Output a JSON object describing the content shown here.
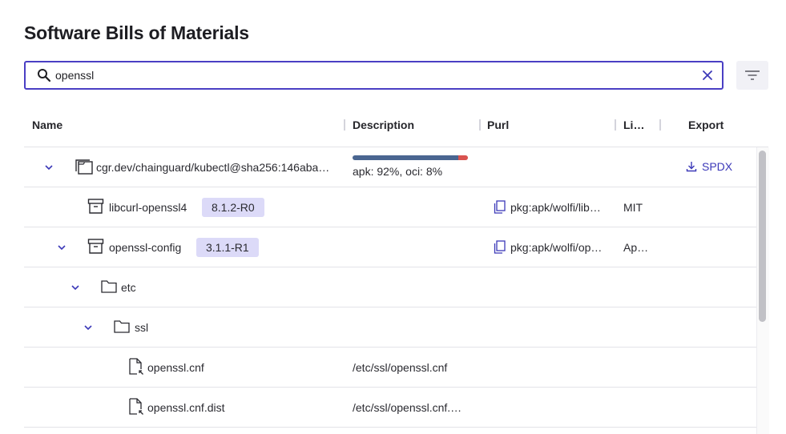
{
  "page": {
    "title": "Software Bills of Materials"
  },
  "search": {
    "value": "openssl",
    "placeholder": "Search"
  },
  "columns": {
    "name": "Name",
    "description": "Description",
    "purl": "Purl",
    "license": "Li…",
    "export": "Export"
  },
  "rows": [
    {
      "type": "image",
      "name": "cgr.dev/chainguard/kubectl@sha256:146aba…",
      "progress": {
        "apk_percent": 92,
        "oci_percent": 8,
        "label": "apk: 92%, oci: 8%"
      },
      "export_label": "SPDX"
    },
    {
      "type": "package",
      "name": "libcurl-openssl4",
      "version": "8.1.2-R0",
      "purl": "pkg:apk/wolfi/lib…",
      "license": "MIT"
    },
    {
      "type": "package",
      "name": "openssl-config",
      "version": "3.1.1-R1",
      "purl": "pkg:apk/wolfi/op…",
      "license": "Ap…"
    },
    {
      "type": "folder",
      "name": "etc"
    },
    {
      "type": "folder",
      "name": "ssl"
    },
    {
      "type": "file",
      "name": "openssl.cnf",
      "description": "/etc/ssl/openssl.cnf"
    },
    {
      "type": "file",
      "name": "openssl.cnf.dist",
      "description": "/etc/ssl/openssl.cnf.…"
    }
  ],
  "colors": {
    "accent": "#4a3fc4",
    "badge_bg": "#dcdaf8",
    "progress_apk": "#4a6691",
    "progress_oci": "#d9534f",
    "link": "#3b38b8"
  }
}
